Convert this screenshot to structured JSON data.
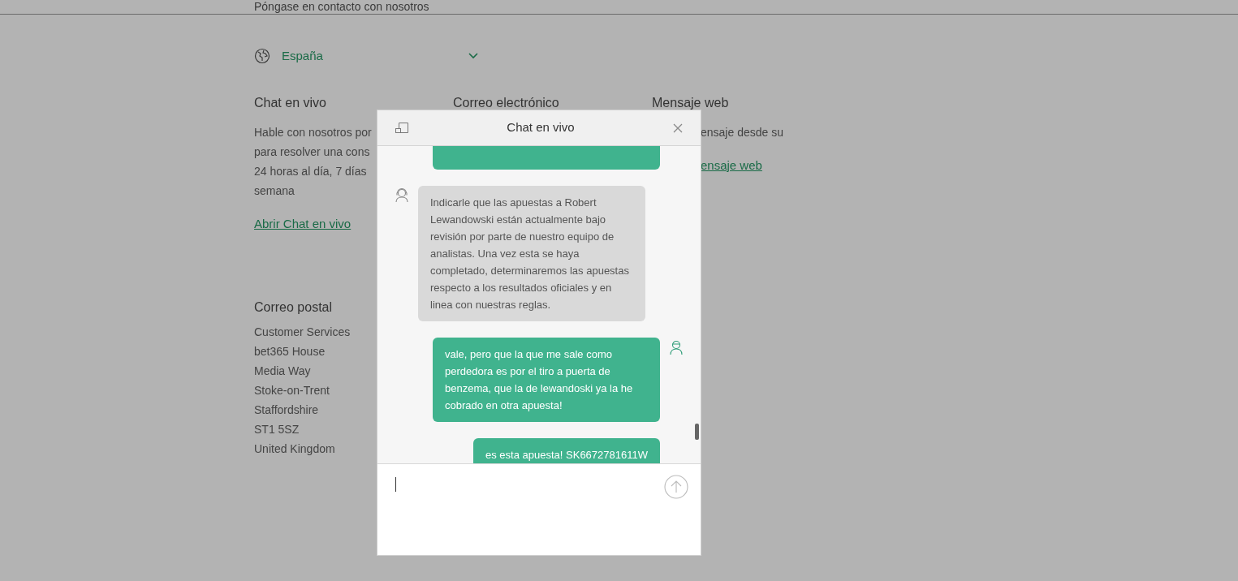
{
  "page": {
    "heading": "Póngase en contacto con nosotros",
    "country": {
      "label": "España"
    },
    "columns": [
      {
        "title": "Chat en vivo",
        "lines": [
          "Hable con nosotros por",
          "para resolver una cons",
          "24 horas al día, 7 días",
          "semana"
        ],
        "link": "Abrir Chat en vivo"
      },
      {
        "title": "Correo electrónico"
      },
      {
        "title": "Mensaje web",
        "lines": [
          "ensaje desde su"
        ],
        "link": "ensaje web"
      }
    ],
    "postal": {
      "title": "Correo postal",
      "lines": [
        "Customer Services",
        "bet365 House",
        "Media Way",
        "Stoke-on-Trent",
        "Staffordshire",
        "ST1 5SZ",
        "United Kingdom"
      ]
    }
  },
  "chat": {
    "title": "Chat en vivo",
    "messages": [
      {
        "kind": "user"
      },
      {
        "kind": "agent",
        "text": "Indicarle que las apuestas a Robert Lewandowski están actualmente bajo revisión por parte de nuestro equipo de analistas. Una vez esta se haya completado, determinaremos las apuestas respecto a los resultados oficiales y en linea con nuestras reglas."
      },
      {
        "kind": "user",
        "text": "vale, pero que la que me sale como perdedora es por el tiro a puerta de benzema, que la de lewandoski ya la he cobrado en otra apuesta!"
      },
      {
        "kind": "user",
        "text": "es esta apuesta! SK6672781611W"
      }
    ]
  }
}
